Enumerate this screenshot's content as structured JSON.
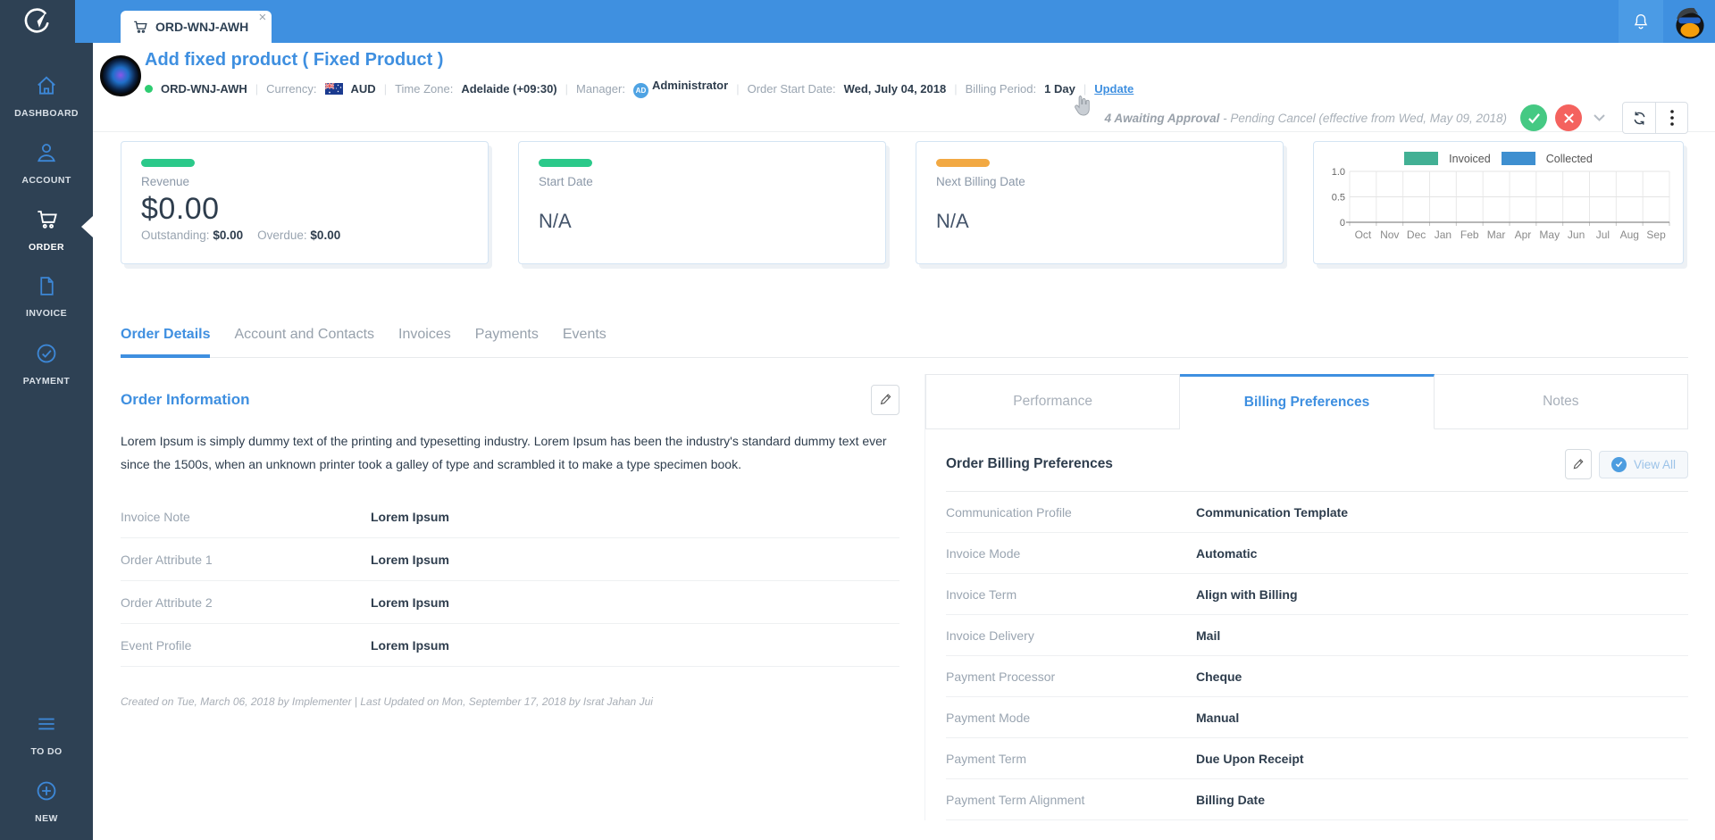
{
  "topbar": {
    "tab_label": "ORD-WNJ-AWH",
    "close_glyph": "×",
    "icons": [
      "cart-icon",
      "bell-icon",
      "penguin-avatar"
    ]
  },
  "sidebar": {
    "items": [
      {
        "id": "dashboard",
        "label": "DASHBOARD",
        "icon": "home-icon",
        "active": false
      },
      {
        "id": "account",
        "label": "ACCOUNT",
        "icon": "person-icon",
        "active": false
      },
      {
        "id": "order",
        "label": "ORDER",
        "icon": "cart-icon",
        "active": true
      },
      {
        "id": "invoice",
        "label": "INVOICE",
        "icon": "document-icon",
        "active": false
      },
      {
        "id": "payment",
        "label": "PAYMENT",
        "icon": "check-circle-icon",
        "active": false
      }
    ],
    "bottom_items": [
      {
        "id": "todo",
        "label": "TO DO",
        "icon": "list-icon",
        "active": false
      },
      {
        "id": "new",
        "label": "NEW",
        "icon": "plus-circle-icon",
        "active": false
      }
    ]
  },
  "header": {
    "title": "Add fixed product ( Fixed Product )",
    "order_id": "ORD-WNJ-AWH",
    "currency_label": "Currency:",
    "currency": "AUD",
    "timezone_label": "Time Zone:",
    "timezone": "Adelaide (+09:30)",
    "manager_label": "Manager:",
    "manager_initials": "AD",
    "manager": "Administrator",
    "start_date_label": "Order Start Date:",
    "start_date": "Wed, July 04, 2018",
    "billing_period_label": "Billing Period:",
    "billing_period": "1 Day",
    "update_link": "Update",
    "status_bold": "4 Awaiting Approval",
    "status_rest": " - Pending Cancel (effective from Wed, May 09, 2018)"
  },
  "cards": {
    "revenue": {
      "label": "Revenue",
      "value": "$0.00",
      "outstanding_label": "Outstanding:",
      "outstanding": "$0.00",
      "overdue_label": "Overdue:",
      "overdue": "$0.00",
      "accent": "#2BC98A"
    },
    "start_date": {
      "label": "Start Date",
      "value": "N/A",
      "accent": "#2BC98A"
    },
    "next_billing": {
      "label": "Next Billing Date",
      "value": "N/A",
      "accent": "#F2A943"
    }
  },
  "order_tabs": {
    "active_index": 0,
    "items": [
      "Order Details",
      "Account and Contacts",
      "Invoices",
      "Payments",
      "Events"
    ]
  },
  "order_info": {
    "heading": "Order Information",
    "description": "Lorem Ipsum is simply dummy text of the printing and typesetting industry. Lorem Ipsum has been the industry's standard dummy text ever since the 1500s, when an unknown printer took a galley of type and scrambled it to make a type specimen book.",
    "rows": [
      {
        "label": "Invoice Note",
        "value": "Lorem Ipsum"
      },
      {
        "label": "Order Attribute 1",
        "value": "Lorem Ipsum"
      },
      {
        "label": "Order Attribute 2",
        "value": "Lorem Ipsum"
      },
      {
        "label": "Event Profile",
        "value": "Lorem Ipsum"
      }
    ],
    "footer": "Created on Tue, March 06, 2018 by Implementer | Last Updated on Mon, September 17, 2018 by Israt Jahan Jui"
  },
  "billing_panel": {
    "tabs": [
      "Performance",
      "Billing Preferences",
      "Notes"
    ],
    "active_index": 1,
    "heading": "Order Billing Preferences",
    "view_all_label": "View All",
    "rows": [
      {
        "label": "Communication Profile",
        "value": "Communication Template"
      },
      {
        "label": "Invoice Mode",
        "value": "Automatic"
      },
      {
        "label": "Invoice Term",
        "value": "Align with Billing"
      },
      {
        "label": "Invoice Delivery",
        "value": "Mail"
      },
      {
        "label": "Payment Processor",
        "value": "Cheque"
      },
      {
        "label": "Payment Mode",
        "value": "Manual"
      },
      {
        "label": "Payment Term",
        "value": "Due Upon Receipt"
      },
      {
        "label": "Payment Term Alignment",
        "value": "Billing Date"
      }
    ]
  },
  "chart_data": {
    "type": "bar",
    "categories": [
      "Oct",
      "Nov",
      "Dec",
      "Jan",
      "Feb",
      "Mar",
      "Apr",
      "May",
      "Jun",
      "Jul",
      "Aug",
      "Sep"
    ],
    "series": [
      {
        "name": "Invoiced",
        "color": "#42B094",
        "values": [
          0,
          0,
          0,
          0,
          0,
          0,
          0,
          0,
          0,
          0,
          0,
          0
        ]
      },
      {
        "name": "Collected",
        "color": "#3E8FD0",
        "values": [
          0,
          0,
          0,
          0,
          0,
          0,
          0,
          0,
          0,
          0,
          0,
          0
        ]
      }
    ],
    "title": "",
    "xlabel": "",
    "ylabel": "",
    "ylim": [
      0,
      1.0
    ],
    "ytick_labels_top_to_bottom": [
      "1.0",
      "0.5",
      "0"
    ],
    "grid": true,
    "legend_position": "top"
  },
  "colors": {
    "topbar_blue": "#3F90E0",
    "sidebar_navy": "#2E4154",
    "accent_blue": "#3E8FE0",
    "green": "#2BC98A",
    "orange": "#F2A943",
    "approve_green": "#45C983",
    "reject_red": "#F4625E"
  }
}
